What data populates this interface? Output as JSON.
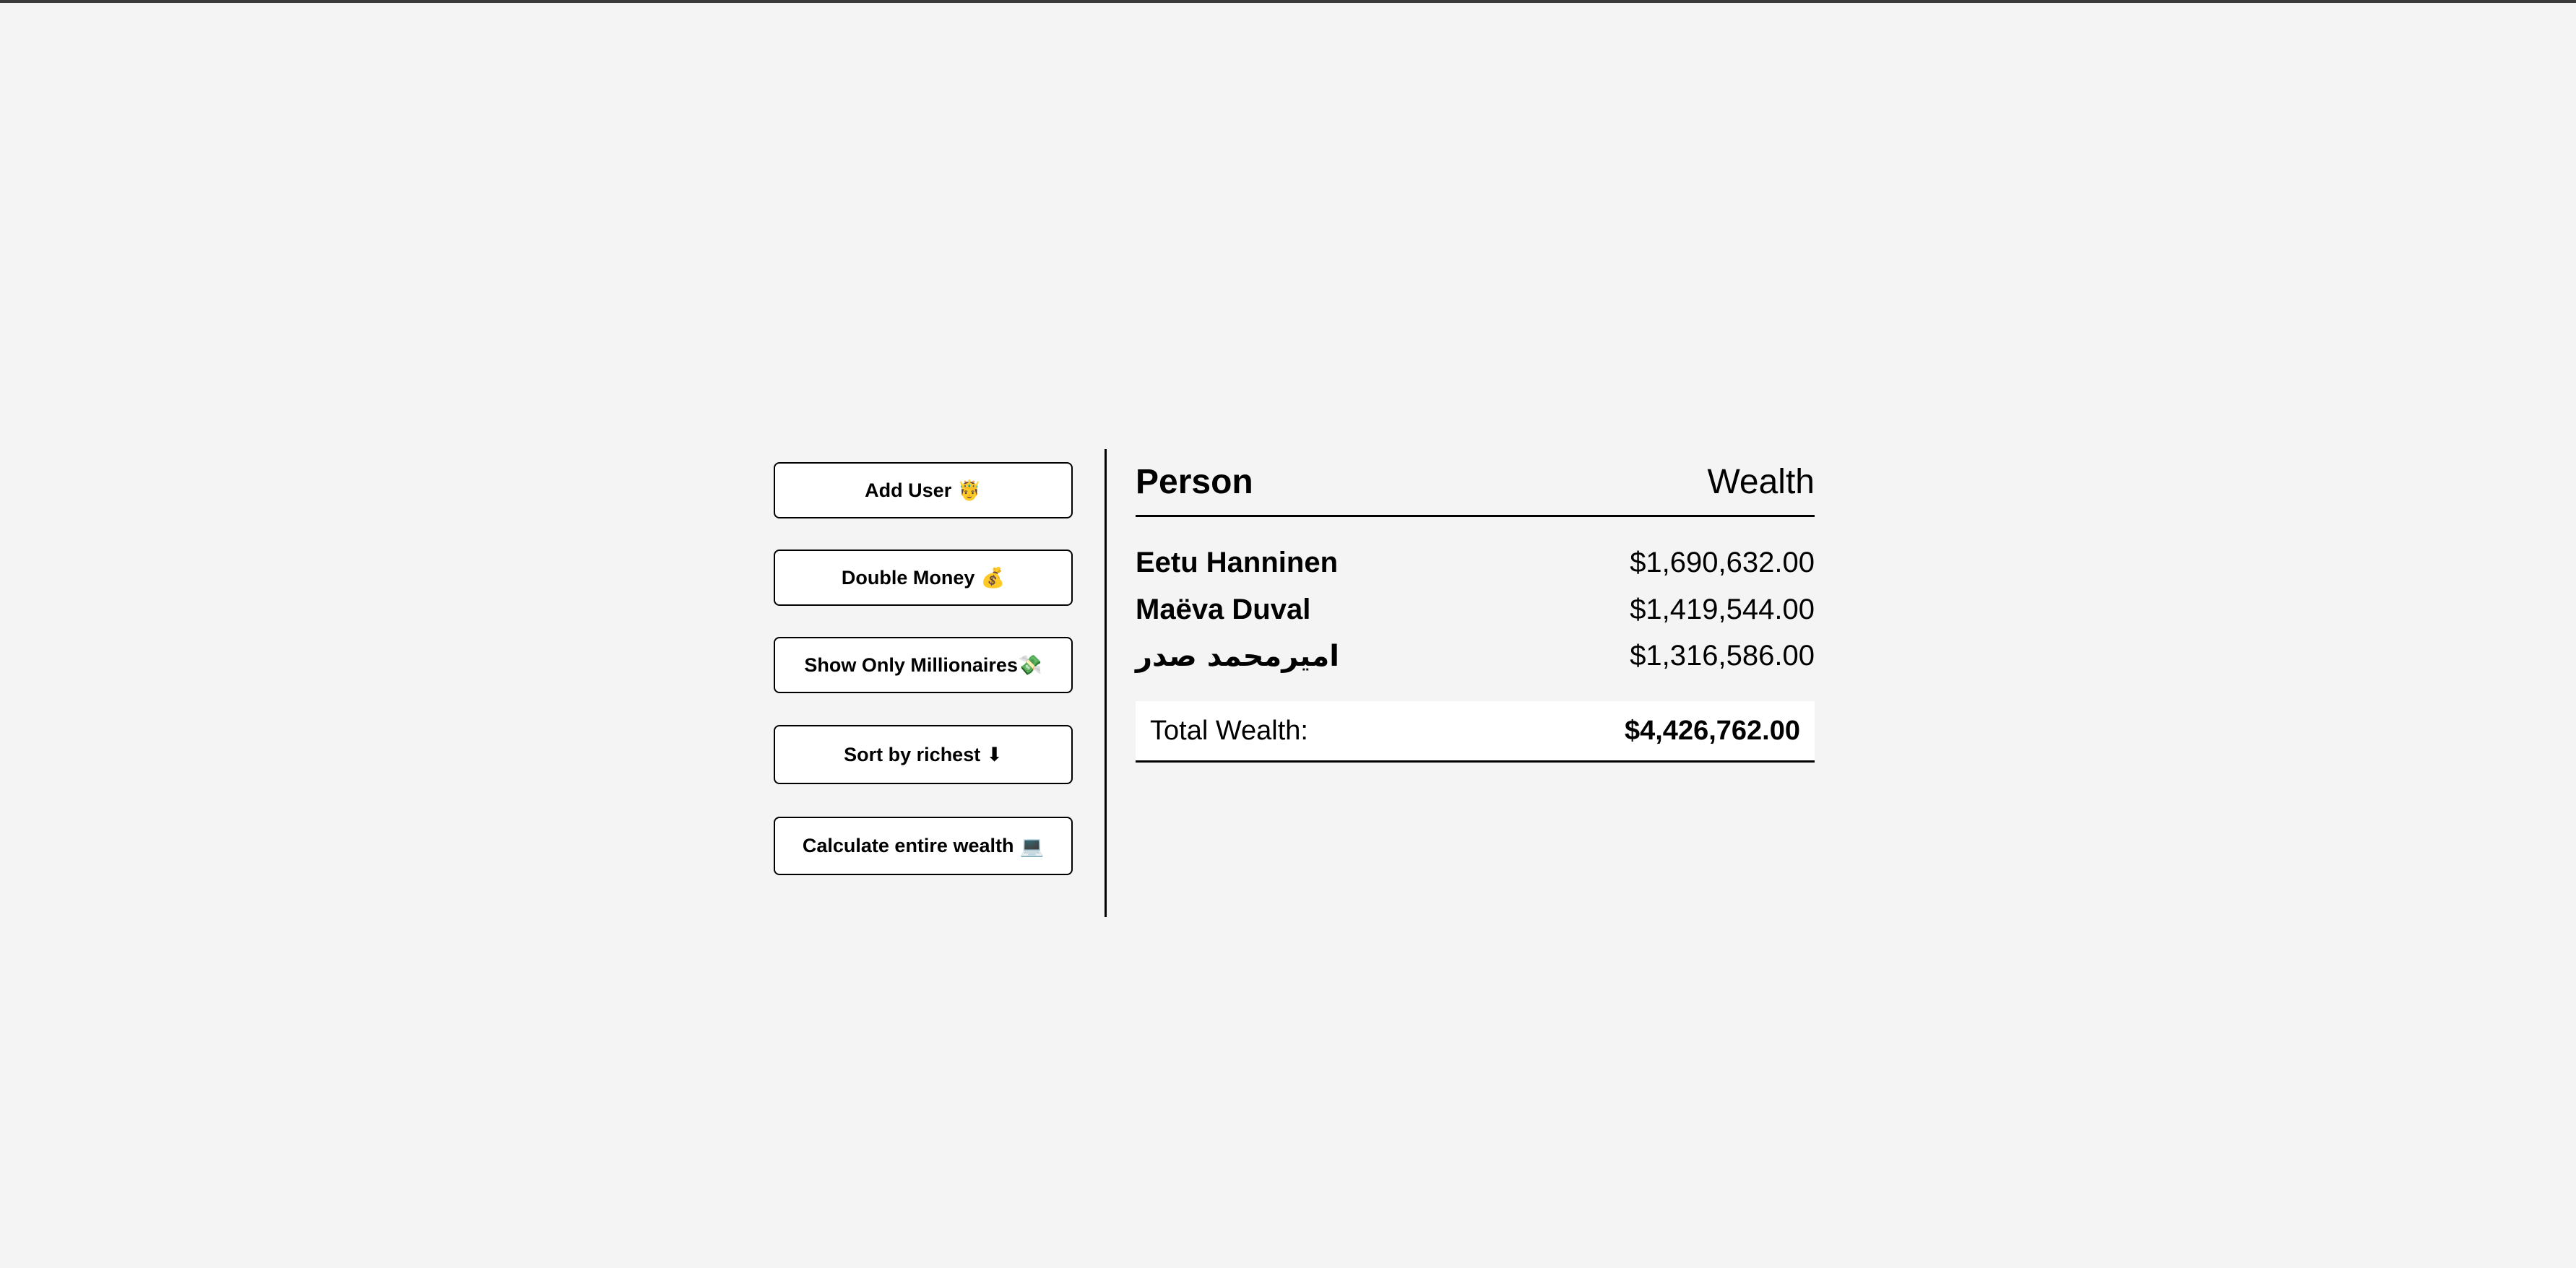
{
  "colors": {
    "background": "#f4f4f4",
    "button_background": "#ffffff",
    "border": "#000000"
  },
  "actions": {
    "add_user": {
      "label": "Add User",
      "icon": "person-icon",
      "emoji": "🤴"
    },
    "double_money": {
      "label": "Double Money",
      "icon": "money-bag-icon",
      "emoji": "💰"
    },
    "show_millionaires": {
      "label": "Show Only Millionaires",
      "icon": "flying-money-icon",
      "emoji": "💸"
    },
    "sort_richest": {
      "label": "Sort by richest",
      "icon": "down-arrow-icon",
      "emoji": "⬇"
    },
    "calculate_wealth": {
      "label": "Calculate entire wealth",
      "icon": "laptop-icon",
      "emoji": "💻"
    }
  },
  "table": {
    "header_person": "Person",
    "header_wealth": "Wealth",
    "rows": [
      {
        "name": "Eetu Hanninen",
        "wealth": "$1,690,632.00"
      },
      {
        "name": "Maëva Duval",
        "wealth": "$1,419,544.00"
      },
      {
        "name": "امیرمحمد صدر",
        "wealth": "$1,316,586.00"
      }
    ],
    "total_label": "Total Wealth:",
    "total_value": "$4,426,762.00"
  }
}
